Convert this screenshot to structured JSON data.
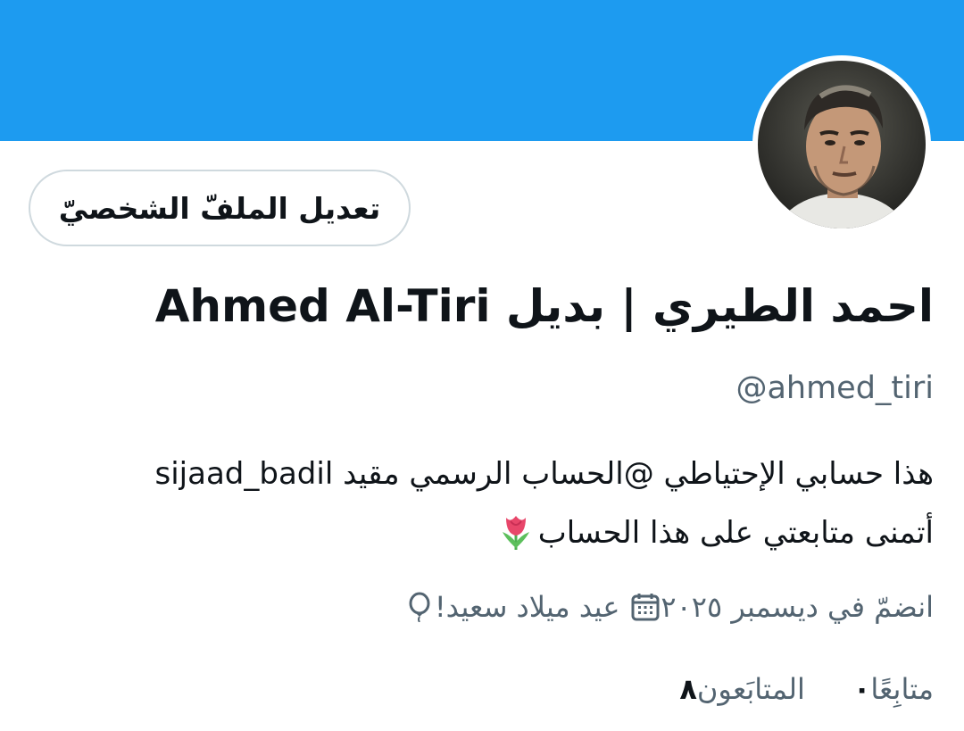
{
  "profile": {
    "display_name": "احمد الطيري | بديل Ahmed Al-Tiri",
    "handle": "@ahmed_tiri",
    "edit_button_label": "تعديل الملفّ الشخصيّ",
    "bio_line_1": "هذا حسابي الإحتياطي @الحساب الرسمي مقيد sijaad_badil",
    "bio_line_2": "أتمنى متابعتي على هذا الحساب",
    "bio_emoji": "tulip-icon",
    "birthday_text": "عيد ميلاد سعيد!",
    "joined_text": "انضمّ في ديسمبر ٢٠٢٥",
    "following_count": "٠",
    "following_label": "متابِعًا",
    "followers_count": "٨",
    "followers_label": "المتابَعون"
  },
  "colors": {
    "banner": "#1d9bf0",
    "secondary_text": "#536471",
    "primary_text": "#0f1419",
    "button_border": "#cfd9de"
  },
  "icons": {
    "birthday": "balloon-icon",
    "joined": "calendar-icon"
  }
}
